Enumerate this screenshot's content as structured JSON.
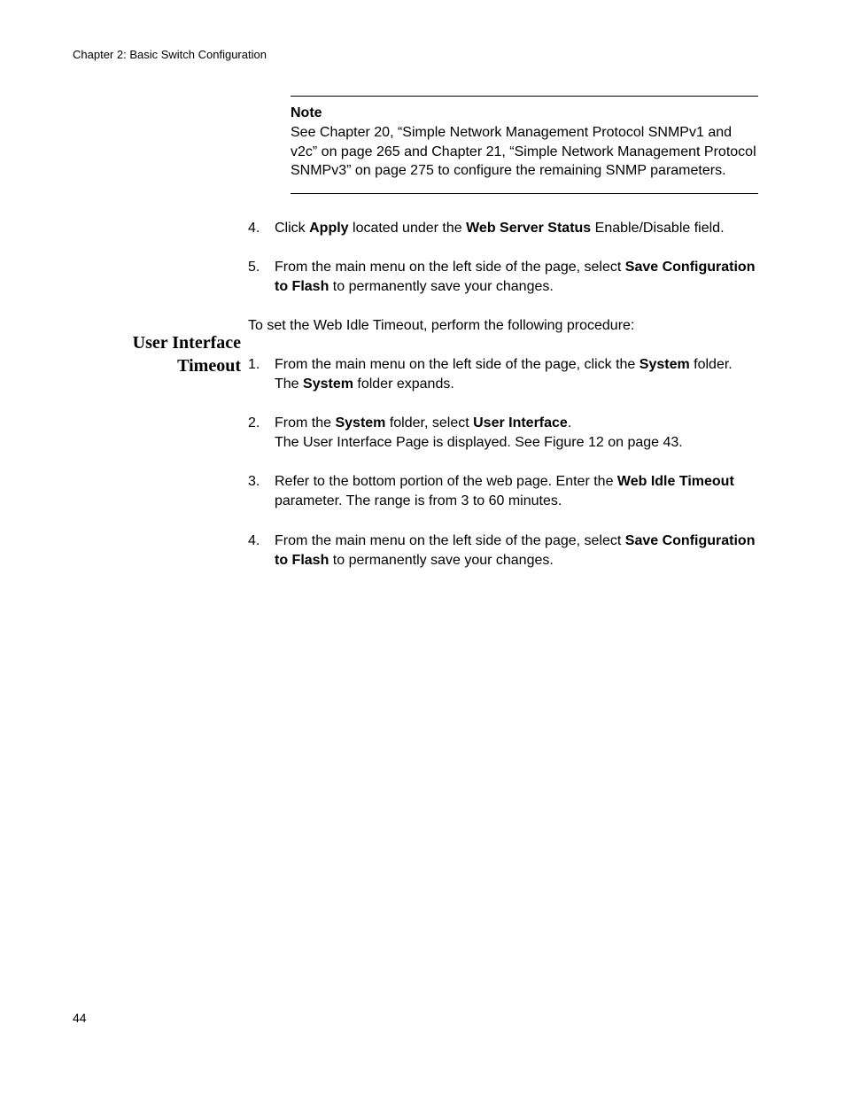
{
  "header": {
    "running_head": "Chapter 2: Basic Switch Configuration"
  },
  "note": {
    "label": "Note",
    "text_pre": "See Chapter 20, “Simple Network Management Protocol SNMPv1 and v2c” on page 265 and Chapter 21, “Simple Network Management Protocol SNMPv3” on page 275 to configure the remaining SNMP parameters."
  },
  "first_list": {
    "step4": {
      "num": "4.",
      "p1a": "Click ",
      "p1b": "Apply",
      "p1c": " located under the ",
      "p1d": "Web Server Status",
      "p1e": " Enable/Disable field."
    },
    "step5": {
      "num": "5.",
      "p1a": "From the main menu on the left side of the page, select ",
      "p1b": "Save Configuration to Flash",
      "p1c": " to permanently save your changes."
    }
  },
  "section2": {
    "side_heading": "User Interface Timeout",
    "intro": "To set the Web Idle Timeout, perform the following procedure:",
    "step1": {
      "num": "1.",
      "p1a": "From the main menu on the left side of the page, click the ",
      "p1b": "System",
      "p1c": " folder.",
      "p2a": "The ",
      "p2b": "System",
      "p2c": " folder expands."
    },
    "step2": {
      "num": "2.",
      "p1a": "From the ",
      "p1b": "System",
      "p1c": " folder, select ",
      "p1d": "User Interface",
      "p1e": ".",
      "p2": "The User Interface Page is displayed. See Figure 12 on page 43."
    },
    "step3": {
      "num": "3.",
      "p1a": "Refer to the bottom portion of the web page. Enter the ",
      "p1b": "Web Idle Timeout",
      "p1c": " parameter. The range is from 3 to 60 minutes."
    },
    "step4": {
      "num": "4.",
      "p1a": "From the main menu on the left side of the page, select ",
      "p1b": "Save Configuration to Flash",
      "p1c": " to permanently save your changes."
    }
  },
  "footer": {
    "page_number": "44"
  }
}
